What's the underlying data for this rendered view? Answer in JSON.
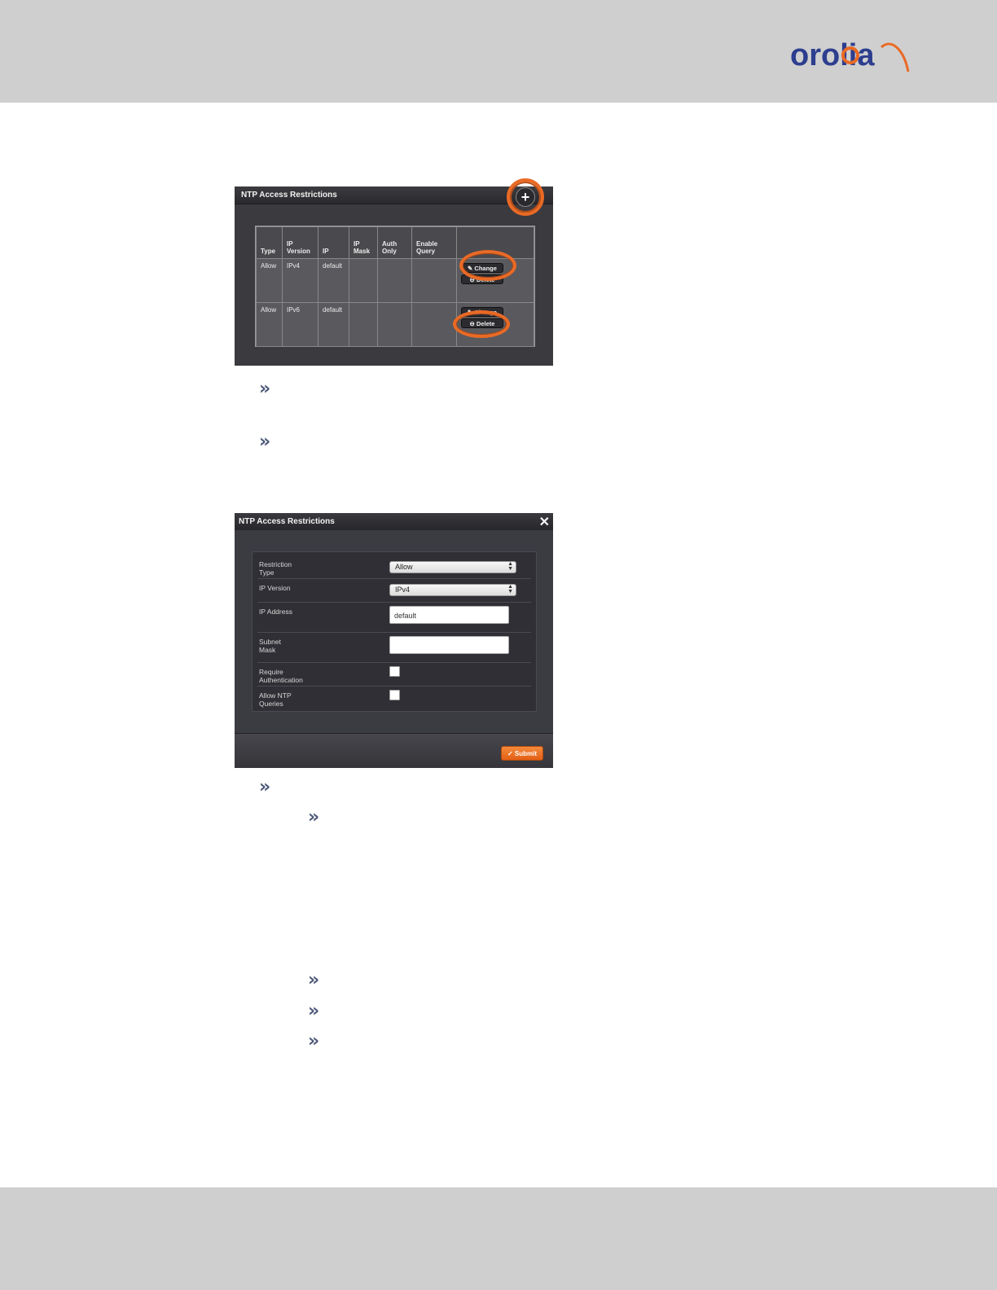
{
  "brand": {
    "logo_text": "orolia",
    "accent": "#e96a25",
    "brand_blue": "#2d3e8f"
  },
  "table_panel": {
    "title": "NTP Access Restrictions",
    "add_icon": "plus-icon",
    "columns": [
      [
        "",
        "Type"
      ],
      [
        "IP",
        "Version"
      ],
      [
        "",
        "IP"
      ],
      [
        "IP",
        "Mask"
      ],
      [
        "Auth",
        "Only"
      ],
      [
        "Enable",
        "Query"
      ],
      [
        "",
        ""
      ]
    ],
    "rows": [
      {
        "type": "Allow",
        "ip_version": "IPv4",
        "ip": "default",
        "ip_mask": "",
        "auth_only": "",
        "enable_query": ""
      },
      {
        "type": "Allow",
        "ip_version": "IPv6",
        "ip": "default",
        "ip_mask": "",
        "auth_only": "",
        "enable_query": ""
      }
    ],
    "change_label": "Change",
    "delete_label": "Delete"
  },
  "form_panel": {
    "title": "NTP Access Restrictions",
    "close_icon": "close-icon",
    "fields": {
      "restriction_type": {
        "label_line1": "Restriction",
        "label_line2": "Type",
        "value": "Allow"
      },
      "ip_version": {
        "label": "IP Version",
        "value": "IPv4"
      },
      "ip_address": {
        "label": "IP Address",
        "value": "default"
      },
      "subnet_mask": {
        "label_line1": "Subnet",
        "label_line2": "Mask",
        "value": ""
      },
      "require_auth": {
        "label_line1": "Require",
        "label_line2": "Authentication",
        "checked": false
      },
      "allow_queries": {
        "label_line1": "Allow NTP",
        "label_line2": "Queries",
        "checked": false
      }
    },
    "submit_label": "Submit"
  },
  "bullet_glyph": "»"
}
